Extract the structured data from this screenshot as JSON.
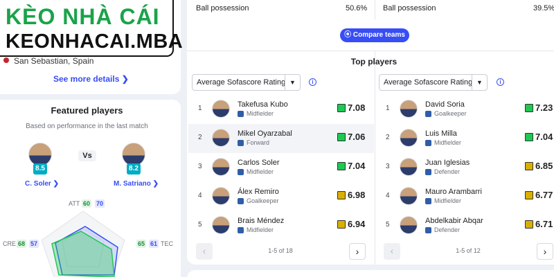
{
  "logo": {
    "line1": "KÈO NHÀ CÁI",
    "line2": "KEONHACAI.MBA"
  },
  "venue": {
    "location": "San Sebastian, Spain",
    "see_more": "See more details  ❯"
  },
  "featured": {
    "title": "Featured players",
    "subtitle": "Based on performance in the last match",
    "vs": "Vs",
    "left": {
      "name": "C. Soler  ❯",
      "rating": "8.5"
    },
    "right": {
      "name": "M. Satriano  ❯",
      "rating": "8.2"
    },
    "stats": {
      "att": {
        "label": "ATT",
        "a": "60",
        "b": "70"
      },
      "cre": {
        "label": "CRE",
        "a": "68",
        "b": "57"
      },
      "tec": {
        "label": "TEC",
        "a": "65",
        "b": "61"
      }
    }
  },
  "possession": {
    "left": {
      "label": "Ball possession",
      "value": "50.6%"
    },
    "right": {
      "label": "Ball possession",
      "value": "39.5%"
    }
  },
  "compare_button": "⦿ Compare teams",
  "top_players": {
    "title": "Top players",
    "left": {
      "select": "Average Sofascore Rating",
      "pager": "1-5 of 18",
      "rows": [
        {
          "rank": "1",
          "name": "Takefusa Kubo",
          "position": "Midfielder",
          "rating": "7.08",
          "color": "#1ec853"
        },
        {
          "rank": "2",
          "name": "Mikel Oyarzabal",
          "position": "Forward",
          "rating": "7.06",
          "color": "#1ec853"
        },
        {
          "rank": "3",
          "name": "Carlos Soler",
          "position": "Midfielder",
          "rating": "7.04",
          "color": "#1ec853"
        },
        {
          "rank": "4",
          "name": "Álex Remiro",
          "position": "Goalkeeper",
          "rating": "6.98",
          "color": "#d9af00"
        },
        {
          "rank": "5",
          "name": "Brais Méndez",
          "position": "Midfielder",
          "rating": "6.94",
          "color": "#d9af00"
        }
      ]
    },
    "right": {
      "select": "Average Sofascore Rating",
      "pager": "1-5 of 12",
      "rows": [
        {
          "rank": "1",
          "name": "David Soria",
          "position": "Goalkeeper",
          "rating": "7.23",
          "color": "#1ec853"
        },
        {
          "rank": "2",
          "name": "Luis Milla",
          "position": "Midfielder",
          "rating": "7.04",
          "color": "#1ec853"
        },
        {
          "rank": "3",
          "name": "Juan Iglesias",
          "position": "Defender",
          "rating": "6.85",
          "color": "#d9af00"
        },
        {
          "rank": "4",
          "name": "Mauro Arambarri",
          "position": "Midfielder",
          "rating": "6.77",
          "color": "#d9af00"
        },
        {
          "rank": "5",
          "name": "Abdelkabir Abqar",
          "position": "Defender",
          "rating": "6.71",
          "color": "#d9af00"
        }
      ]
    }
  }
}
